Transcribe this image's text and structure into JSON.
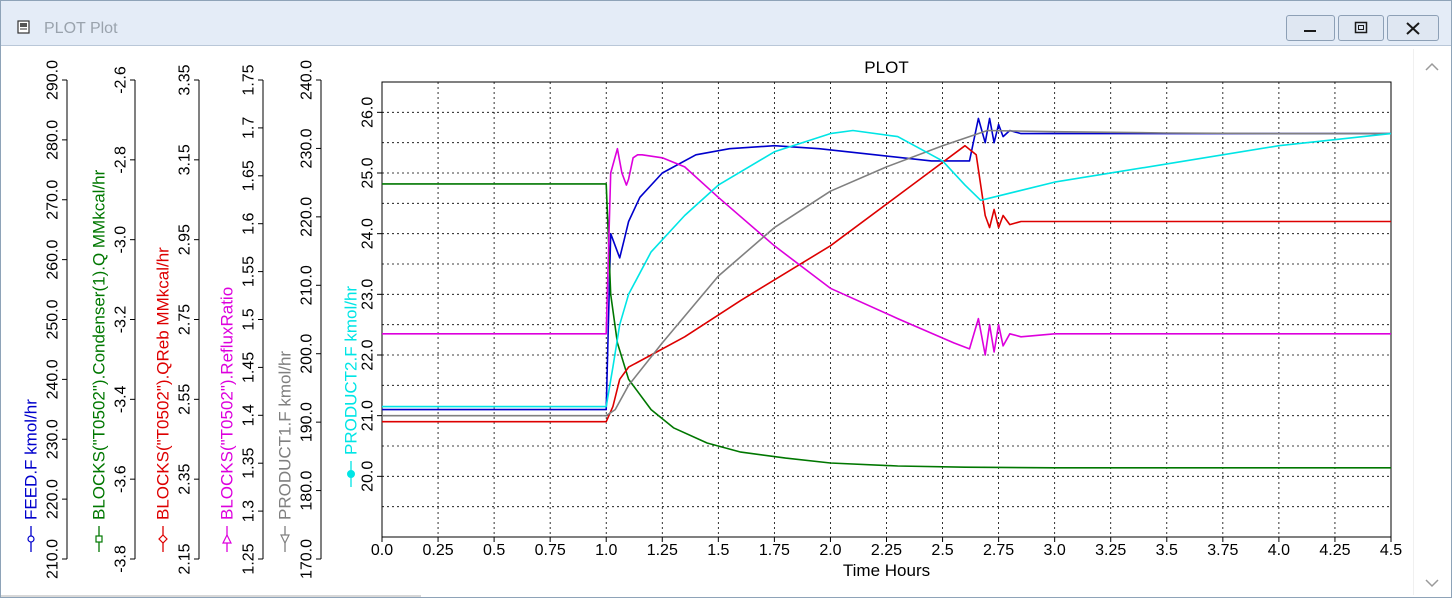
{
  "window": {
    "title": "PLOT Plot",
    "icon": "window-app-icon",
    "minimize_icon": "minimize-icon",
    "maximize_icon": "maximize-icon",
    "close_icon": "close-icon"
  },
  "scrollbar": {
    "up_icon": "chevron-up-icon",
    "down_icon": "chevron-down-icon"
  },
  "axes_left": [
    {
      "label": "FEED.F kmol/hr",
      "color": "#0000cc",
      "marker": "circle",
      "ticks": [
        "210.0",
        "220.0",
        "230.0",
        "240.0",
        "250.0",
        "260.0",
        "270.0",
        "280.0",
        "290.0"
      ],
      "range": [
        210.0,
        290.0
      ]
    },
    {
      "label": "BLOCKS(\"T0502\").Condenser(1).Q MMkcal/hr",
      "color": "#007700",
      "marker": "square",
      "ticks": [
        "-3.8",
        "-3.6",
        "-3.4",
        "-3.2",
        "-3.0",
        "-2.8",
        "-2.6"
      ],
      "range": [
        -3.8,
        -2.6
      ]
    },
    {
      "label": "BLOCKS(\"T0502\").QReb MMkcal/hr",
      "color": "#dd0000",
      "marker": "diamond",
      "ticks": [
        "2.15",
        "2.35",
        "2.55",
        "2.75",
        "2.95",
        "3.15",
        "3.35"
      ],
      "range": [
        2.15,
        3.35
      ]
    },
    {
      "label": "BLOCKS(\"T0502\").RefluxRatio",
      "color": "#dd00dd",
      "marker": "triangle-up",
      "ticks": [
        "1.25",
        "1.3",
        "1.35",
        "1.4",
        "1.45",
        "1.5",
        "1.55",
        "1.6",
        "1.65",
        "1.7",
        "1.75"
      ],
      "range": [
        1.25,
        1.75
      ]
    },
    {
      "label": "PRODUCT1.F kmol/hr",
      "color": "#808080",
      "marker": "triangle-down",
      "ticks": [
        "170.0",
        "180.0",
        "190.0",
        "200.0",
        "210.0",
        "220.0",
        "230.0",
        "240.0"
      ],
      "range": [
        170.0,
        240.0
      ]
    },
    {
      "label": "PRODUCT2.F kmol/hr",
      "color": "#00e5e5",
      "marker": "filled-circle",
      "ticks": [
        "20.0",
        "21.0",
        "22.0",
        "23.0",
        "24.0",
        "25.0",
        "26.0"
      ],
      "range": [
        19.0,
        26.5
      ]
    }
  ],
  "chart_data": {
    "type": "line",
    "title": "PLOT",
    "xlabel": "Time Hours",
    "xlim": [
      0.0,
      4.5
    ],
    "x_ticks": [
      "0.0",
      "0.25",
      "0.5",
      "0.75",
      "1.0",
      "1.25",
      "1.5",
      "1.75",
      "2.0",
      "2.25",
      "2.5",
      "2.75",
      "3.0",
      "3.25",
      "3.5",
      "3.75",
      "4.0",
      "4.25",
      "4.5"
    ],
    "grid": true,
    "y_ticks": [
      "20.0",
      "21.0",
      "22.0",
      "23.0",
      "24.0",
      "25.0",
      "26.0"
    ],
    "ylim": [
      19.0,
      26.5
    ],
    "series": [
      {
        "name": "FEED.F kmol/hr",
        "color": "#0000cc",
        "x": [
          0,
          1.0,
          1.02,
          1.04,
          1.06,
          1.08,
          1.1,
          1.15,
          1.25,
          1.4,
          1.55,
          1.75,
          1.95,
          2.2,
          2.45,
          2.62,
          2.66,
          2.69,
          2.71,
          2.73,
          2.75,
          2.77,
          2.8,
          2.85,
          3.0,
          3.5,
          4.0,
          4.5
        ],
        "y": [
          21.1,
          21.1,
          24.0,
          23.8,
          23.6,
          23.9,
          24.2,
          24.6,
          25.0,
          25.3,
          25.4,
          25.45,
          25.4,
          25.3,
          25.2,
          25.2,
          25.9,
          25.5,
          25.9,
          25.5,
          25.8,
          25.6,
          25.7,
          25.65,
          25.65,
          25.65,
          25.65,
          25.65
        ]
      },
      {
        "name": "BLOCKS(\"T0502\").Condenser(1).Q MMkcal/hr",
        "color": "#007700",
        "x": [
          0,
          1.0,
          1.02,
          1.05,
          1.1,
          1.2,
          1.3,
          1.45,
          1.6,
          1.8,
          2.0,
          2.3,
          2.6,
          3.0,
          3.5,
          4.0,
          4.5
        ],
        "y": [
          24.82,
          24.82,
          23.0,
          22.2,
          21.6,
          21.1,
          20.8,
          20.55,
          20.4,
          20.3,
          20.22,
          20.17,
          20.15,
          20.14,
          20.14,
          20.14,
          20.14
        ]
      },
      {
        "name": "BLOCKS(\"T0502\").QReb MMkcal/hr",
        "color": "#dd0000",
        "x": [
          0,
          1.0,
          1.03,
          1.06,
          1.1,
          1.2,
          1.35,
          1.6,
          2.0,
          2.4,
          2.6,
          2.65,
          2.69,
          2.71,
          2.73,
          2.75,
          2.77,
          2.8,
          2.85,
          3.0,
          3.5,
          4.0,
          4.5
        ],
        "y": [
          20.9,
          20.9,
          21.15,
          21.6,
          21.8,
          22.0,
          22.3,
          22.9,
          23.8,
          24.9,
          25.45,
          25.3,
          24.3,
          24.1,
          24.4,
          24.1,
          24.3,
          24.15,
          24.2,
          24.2,
          24.2,
          24.2,
          24.2
        ]
      },
      {
        "name": "BLOCKS(\"T0502\").RefluxRatio",
        "color": "#dd00dd",
        "x": [
          0,
          1.0,
          1.02,
          1.05,
          1.07,
          1.09,
          1.1,
          1.12,
          1.14,
          1.16,
          1.25,
          1.35,
          1.5,
          1.75,
          2.0,
          2.3,
          2.55,
          2.62,
          2.66,
          2.69,
          2.71,
          2.73,
          2.75,
          2.77,
          2.8,
          2.85,
          3.0,
          3.5,
          4.0,
          4.5
        ],
        "y": [
          22.35,
          22.35,
          25.0,
          25.4,
          25.0,
          24.8,
          24.9,
          25.25,
          25.3,
          25.3,
          25.25,
          25.1,
          24.6,
          23.8,
          23.1,
          22.6,
          22.2,
          22.1,
          22.6,
          22.0,
          22.5,
          22.05,
          22.5,
          22.15,
          22.35,
          22.3,
          22.35,
          22.35,
          22.35,
          22.35
        ]
      },
      {
        "name": "PRODUCT1.F kmol/hr",
        "color": "#808080",
        "x": [
          0,
          1.0,
          1.04,
          1.1,
          1.25,
          1.5,
          1.75,
          2.0,
          2.25,
          2.5,
          2.7,
          3.0,
          3.5,
          4.0,
          4.5
        ],
        "y": [
          21.0,
          21.0,
          21.1,
          21.5,
          22.2,
          23.3,
          24.1,
          24.7,
          25.1,
          25.45,
          25.7,
          25.68,
          25.66,
          25.65,
          25.65
        ]
      },
      {
        "name": "PRODUCT2.F kmol/hr",
        "color": "#00e5e5",
        "x": [
          0,
          1.0,
          1.03,
          1.06,
          1.1,
          1.2,
          1.35,
          1.5,
          1.75,
          2.0,
          2.1,
          2.3,
          2.5,
          2.6,
          2.67,
          3.0,
          3.5,
          4.0,
          4.5
        ],
        "y": [
          21.15,
          21.15,
          21.8,
          22.5,
          23.0,
          23.7,
          24.3,
          24.8,
          25.35,
          25.65,
          25.7,
          25.6,
          25.2,
          24.8,
          24.55,
          24.85,
          25.15,
          25.45,
          25.65
        ]
      }
    ]
  }
}
